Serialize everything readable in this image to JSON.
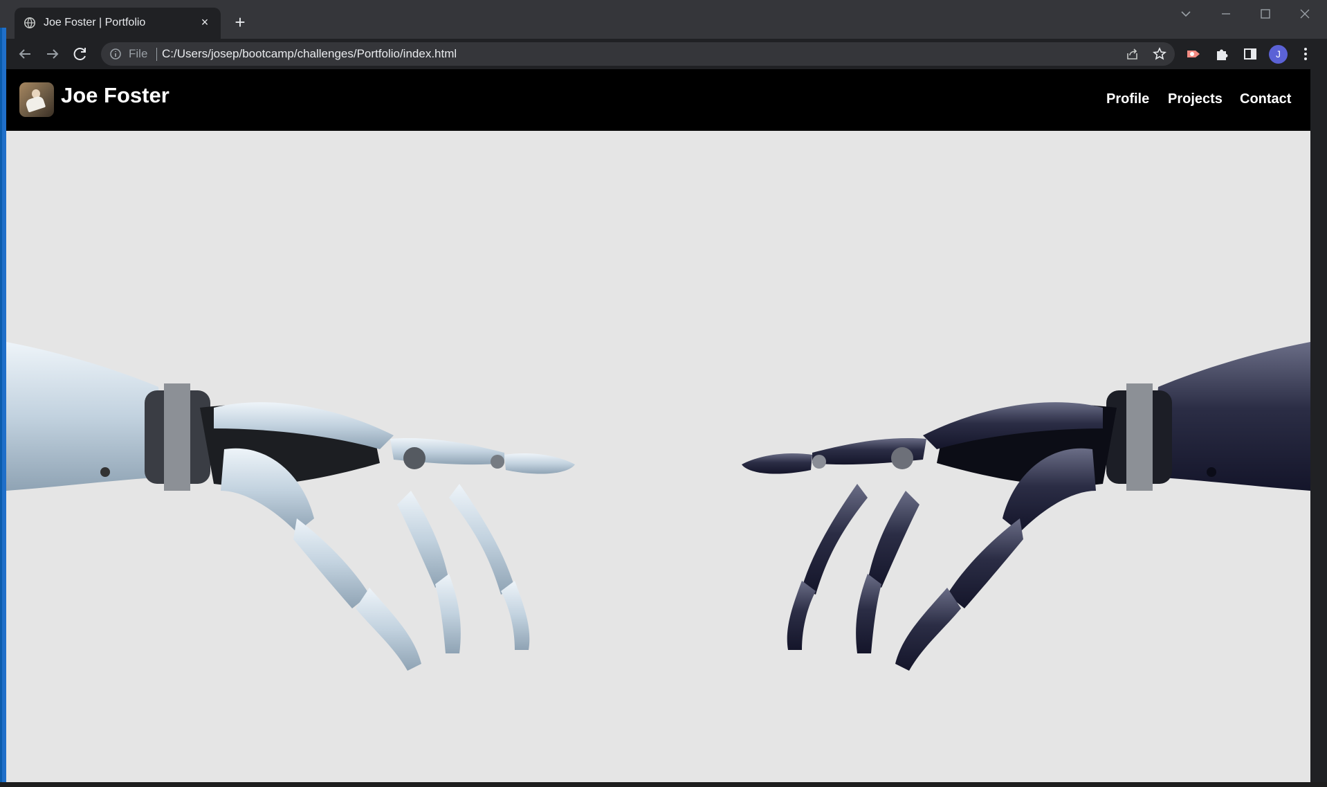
{
  "browser": {
    "tab_title": "Joe Foster | Portfolio",
    "tab_close": "×",
    "new_tab": "+",
    "scheme_label": "File",
    "url": "C:/Users/josep/bootcamp/challenges/Portfolio/index.html",
    "avatar_initial": "J"
  },
  "site": {
    "name": "Joe Foster",
    "nav": [
      "Profile",
      "Projects",
      "Contact"
    ]
  },
  "colors": {
    "header_bg": "#000000",
    "hero_bg": "#e5e5e5",
    "left_hand": "#c9d7e3",
    "right_hand": "#2a2c45"
  }
}
